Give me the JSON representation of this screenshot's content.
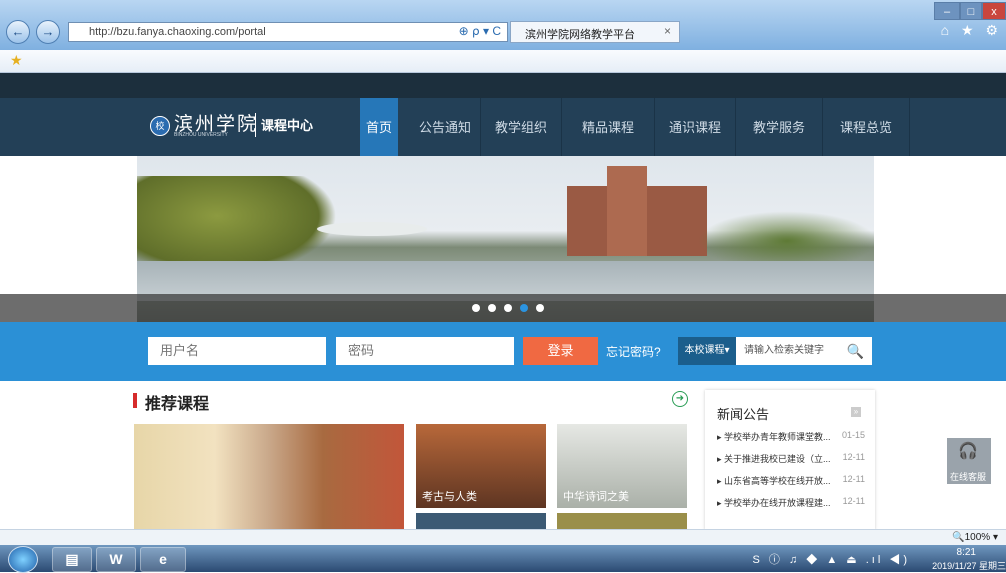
{
  "browser": {
    "url": "http://bzu.fanya.chaoxing.com/portal",
    "tab_title": "滨州学院网络教学平台",
    "tab_close": "×",
    "address_icons": "⊕ ⍴ ▾ C",
    "controls_icons": "⌂ ★ ⚙",
    "win_min": "–",
    "win_max": "□",
    "win_close": "x",
    "back_icon": "←",
    "forward_icon": "→",
    "fav_star": "★"
  },
  "header": {
    "logo_calligraphy": "滨州学院",
    "logo_sub": "BINZHOU UNIVERSITY",
    "logo_center": "课程中心",
    "nav": [
      {
        "label": "首页"
      },
      {
        "label": "公告通知"
      },
      {
        "label": "教学组织"
      },
      {
        "label": "精品课程"
      },
      {
        "label": "通识课程"
      },
      {
        "label": "教学服务"
      },
      {
        "label": "课程总览"
      }
    ]
  },
  "banner": {
    "slide_count": 5,
    "active_slide": 4
  },
  "login": {
    "username_placeholder": "用户名",
    "password_placeholder": "密码",
    "login_button": "登录",
    "forgot": "忘记密码?",
    "scope": "本校课程▾",
    "search_placeholder": "请输入检索关键字",
    "search_icon": "🔍"
  },
  "recommended": {
    "title": "推荐课程",
    "more_icon": "➜",
    "courses": [
      {
        "label": ""
      },
      {
        "label": "考古与人类"
      },
      {
        "label": "中华诗词之美"
      },
      {
        "label": ""
      },
      {
        "label": ""
      }
    ]
  },
  "news": {
    "title": "新闻公告",
    "more_icon": "»",
    "items": [
      {
        "text": "▸ 学校举办青年教师课堂教...",
        "date": "01-15"
      },
      {
        "text": "▸ 关于推进我校已建设（立...",
        "date": "12-11"
      },
      {
        "text": "▸ 山东省高等学校在线开放...",
        "date": "12-11"
      },
      {
        "text": "▸ 学校举办在线开放课程建...",
        "date": "12-11"
      }
    ]
  },
  "service": {
    "label": "在线客服",
    "icon": "🎧"
  },
  "statusbar": {
    "zoom": "🔍100%  ▾"
  },
  "taskbar": {
    "tray": "S ⓘ ♫ ◆ ▲ ⏏ .ıl ◀)",
    "time": "8:21",
    "date": "2019/11/27 星期三"
  }
}
